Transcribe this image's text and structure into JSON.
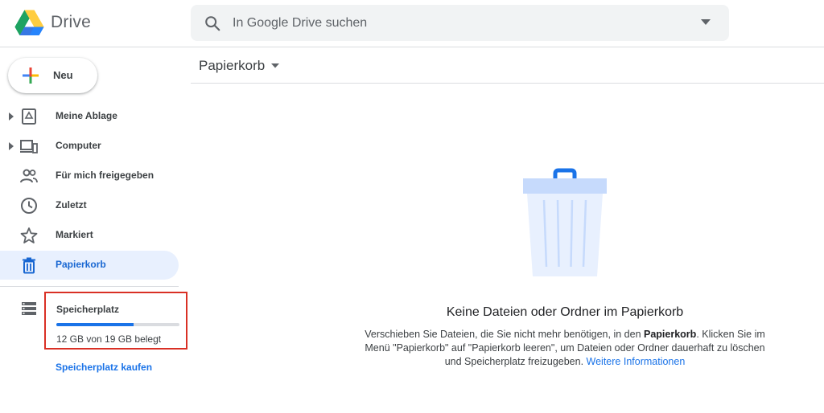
{
  "header": {
    "brand": "Drive",
    "search": {
      "placeholder": "In Google Drive suchen"
    }
  },
  "sidebar": {
    "new_button": "Neu",
    "items": [
      {
        "label": "Meine Ablage",
        "icon": "my-drive-icon",
        "expandable": true
      },
      {
        "label": "Computer",
        "icon": "computer-icon",
        "expandable": true
      },
      {
        "label": "Für mich freigegeben",
        "icon": "shared-icon",
        "expandable": false
      },
      {
        "label": "Zuletzt",
        "icon": "clock-icon",
        "expandable": false
      },
      {
        "label": "Markiert",
        "icon": "star-icon",
        "expandable": false
      },
      {
        "label": "Papierkorb",
        "icon": "trash-icon",
        "expandable": false,
        "active": true
      }
    ],
    "storage": {
      "label": "Speicherplatz",
      "used_text": "12 GB von 19 GB belegt",
      "used_fraction": 0.63,
      "buy_link": "Speicherplatz kaufen"
    }
  },
  "main": {
    "title": "Papierkorb",
    "empty_state": {
      "title": "Keine Dateien oder Ordner im Papierkorb",
      "desc_part1": "Verschieben Sie Dateien, die Sie nicht mehr benötigen, in den ",
      "desc_bold": "Papierkorb",
      "desc_part2": ". Klicken Sie im Menü \"Papierkorb\" auf \"Papierkorb leeren\", um Dateien oder Ordner dauerhaft zu löschen und Speicherplatz freizugeben. ",
      "desc_link": "Weitere Informationen"
    }
  },
  "colors": {
    "accent": "#1a73e8",
    "active_bg": "#e8f0fe",
    "highlight_border": "#d93025"
  }
}
